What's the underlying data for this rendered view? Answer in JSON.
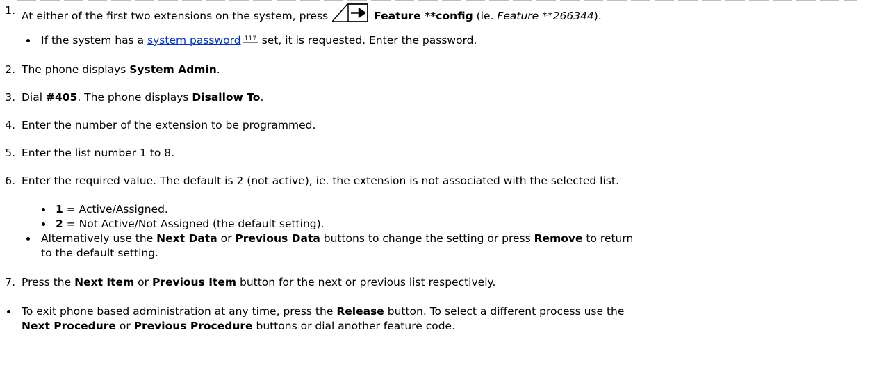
{
  "steps": {
    "s1": {
      "num": "1.",
      "pre": "At either of the first two extensions on the system, press",
      "feature_bold": "Feature **config",
      "paren_open": " (ie. ",
      "example_italic": "Feature **266344",
      "paren_close": ")."
    },
    "s1_sub": {
      "pre": "If the system has a ",
      "link": "system password",
      "pageref": "111",
      "post": " set, it is requested. Enter the password."
    },
    "s2": {
      "num": "2.",
      "pre": "The phone displays ",
      "bold": "System Admin",
      "post": "."
    },
    "s3": {
      "num": "3.",
      "pre": "Dial ",
      "bold1": "#405",
      "mid": ". The phone displays ",
      "bold2": "Disallow To",
      "post": "."
    },
    "s4": {
      "num": "4.",
      "text": "Enter the number of the extension to be programmed."
    },
    "s5": {
      "num": "5.",
      "text": "Enter the list number 1 to 8."
    },
    "s6": {
      "num": "6.",
      "text": "Enter the required value. The default is 2 (not active), ie. the extension is not associated with the selected list."
    },
    "s6_opt1": {
      "bold": "1",
      "post": " = Active/Assigned."
    },
    "s6_opt2": {
      "bold": "2",
      "post": " = Not Active/Not Assigned (the default setting)."
    },
    "s6_alt": {
      "pre": "Alternatively use the ",
      "bold1": "Next Data",
      "mid1": " or ",
      "bold2": "Previous Data",
      "mid2": " buttons to change the setting or press ",
      "bold3": "Remove",
      "post": " to return",
      "line2": "to the default setting."
    },
    "s7": {
      "num": "7.",
      "pre": "Press the ",
      "bold1": "Next Item",
      "mid": " or ",
      "bold2": "Previous Item",
      "post": " button for the next or previous list respectively."
    },
    "note": {
      "pre": "To exit phone based administration at any time, press the ",
      "bold1": "Release",
      "mid": " button. To select a different process use the",
      "bold2": "Next Procedure",
      "mid2": " or ",
      "bold3": "Previous Procedure",
      "post": " buttons or dial another feature code."
    }
  },
  "icons": {
    "feature_key": "feature-arrow-icon"
  }
}
